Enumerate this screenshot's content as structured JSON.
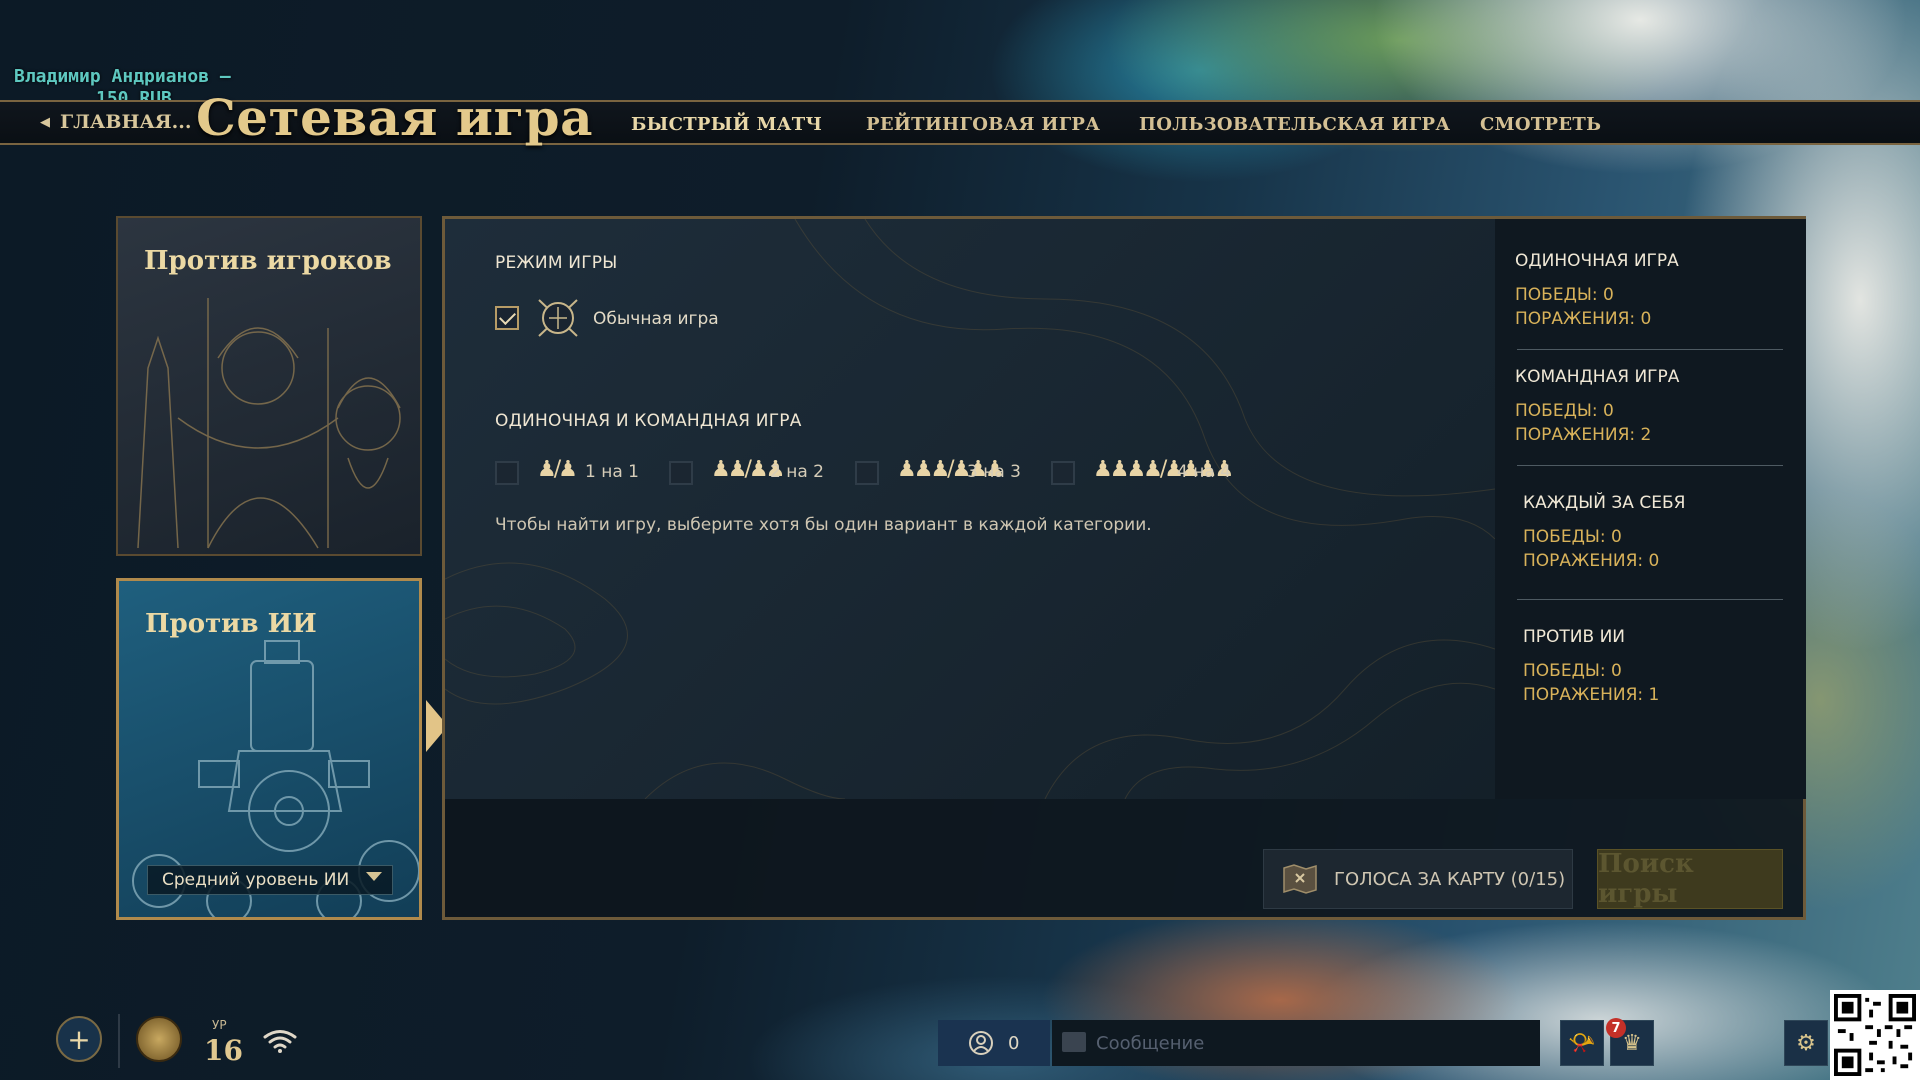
{
  "streamer": {
    "name": "Владимир Андрианов –",
    "amount": "150 RUB"
  },
  "header": {
    "back_label": "ГЛАВНАЯ...",
    "title": "Сетевая игра",
    "tabs": [
      {
        "label": "БЫСТРЫЙ МАТЧ",
        "active": true
      },
      {
        "label": "РЕЙТИНГОВАЯ ИГРА",
        "active": false
      },
      {
        "label": "ПОЛЬЗОВАТЕЛЬСКАЯ ИГРА",
        "active": false
      },
      {
        "label": "СМОТРЕТЬ",
        "active": false
      }
    ]
  },
  "left_cards": {
    "vs_players": {
      "title": "Против игроков"
    },
    "vs_ai": {
      "title": "Против ИИ",
      "difficulty": "Средний уровень ИИ"
    }
  },
  "game_mode": {
    "heading": "РЕЖИМ ИГРЫ",
    "option": {
      "label": "Обычная игра",
      "checked": true
    }
  },
  "team_size": {
    "heading": "ОДИНОЧНАЯ И КОМАНДНАЯ ИГРА",
    "options": [
      {
        "label": "1 на 1",
        "checked": false
      },
      {
        "label": "2 на 2",
        "checked": false
      },
      {
        "label": "3 на 3",
        "checked": false
      },
      {
        "label": "4 на 4",
        "checked": false
      }
    ],
    "hint": "Чтобы найти игру, выберите хотя бы один вариант в каждой категории."
  },
  "stats": [
    {
      "heading": "ОДИНОЧНАЯ ИГРА",
      "wins": "ПОБЕДЫ: 0",
      "losses": "ПОРАЖЕНИЯ: 0"
    },
    {
      "heading": "КОМАНДНАЯ ИГРА",
      "wins": "ПОБЕДЫ: 0",
      "losses": "ПОРАЖЕНИЯ: 2"
    },
    {
      "heading": "КАЖДЫЙ ЗА СЕБЯ",
      "wins": "ПОБЕДЫ: 0",
      "losses": "ПОРАЖЕНИЯ: 0"
    },
    {
      "heading": "ПРОТИВ ИИ",
      "wins": "ПОБЕДЫ: 0",
      "losses": "ПОРАЖЕНИЯ: 1"
    }
  ],
  "actions": {
    "map_vote": "ГОЛОСА ЗА КАРТУ (0/15)",
    "search": "Поиск игры"
  },
  "bottom": {
    "level_label": "УР",
    "level": "16",
    "friends_count": "0",
    "message_placeholder": "Сообщение",
    "notification_count": "7"
  },
  "icons": [
    "plus-icon",
    "emblem-icon",
    "wifi-icon",
    "friends-icon",
    "chat-icon",
    "horn-icon",
    "crown-icon",
    "gear-icon",
    "back-arrow-icon",
    "shield-swords-icon",
    "map-icon",
    "people-icon",
    "qr-code"
  ],
  "colors": {
    "accent_gold": "#e3c98b",
    "stat_gold": "#d8b25a",
    "panel_bg": "#142029",
    "ai_card": "#1f5f7e"
  }
}
